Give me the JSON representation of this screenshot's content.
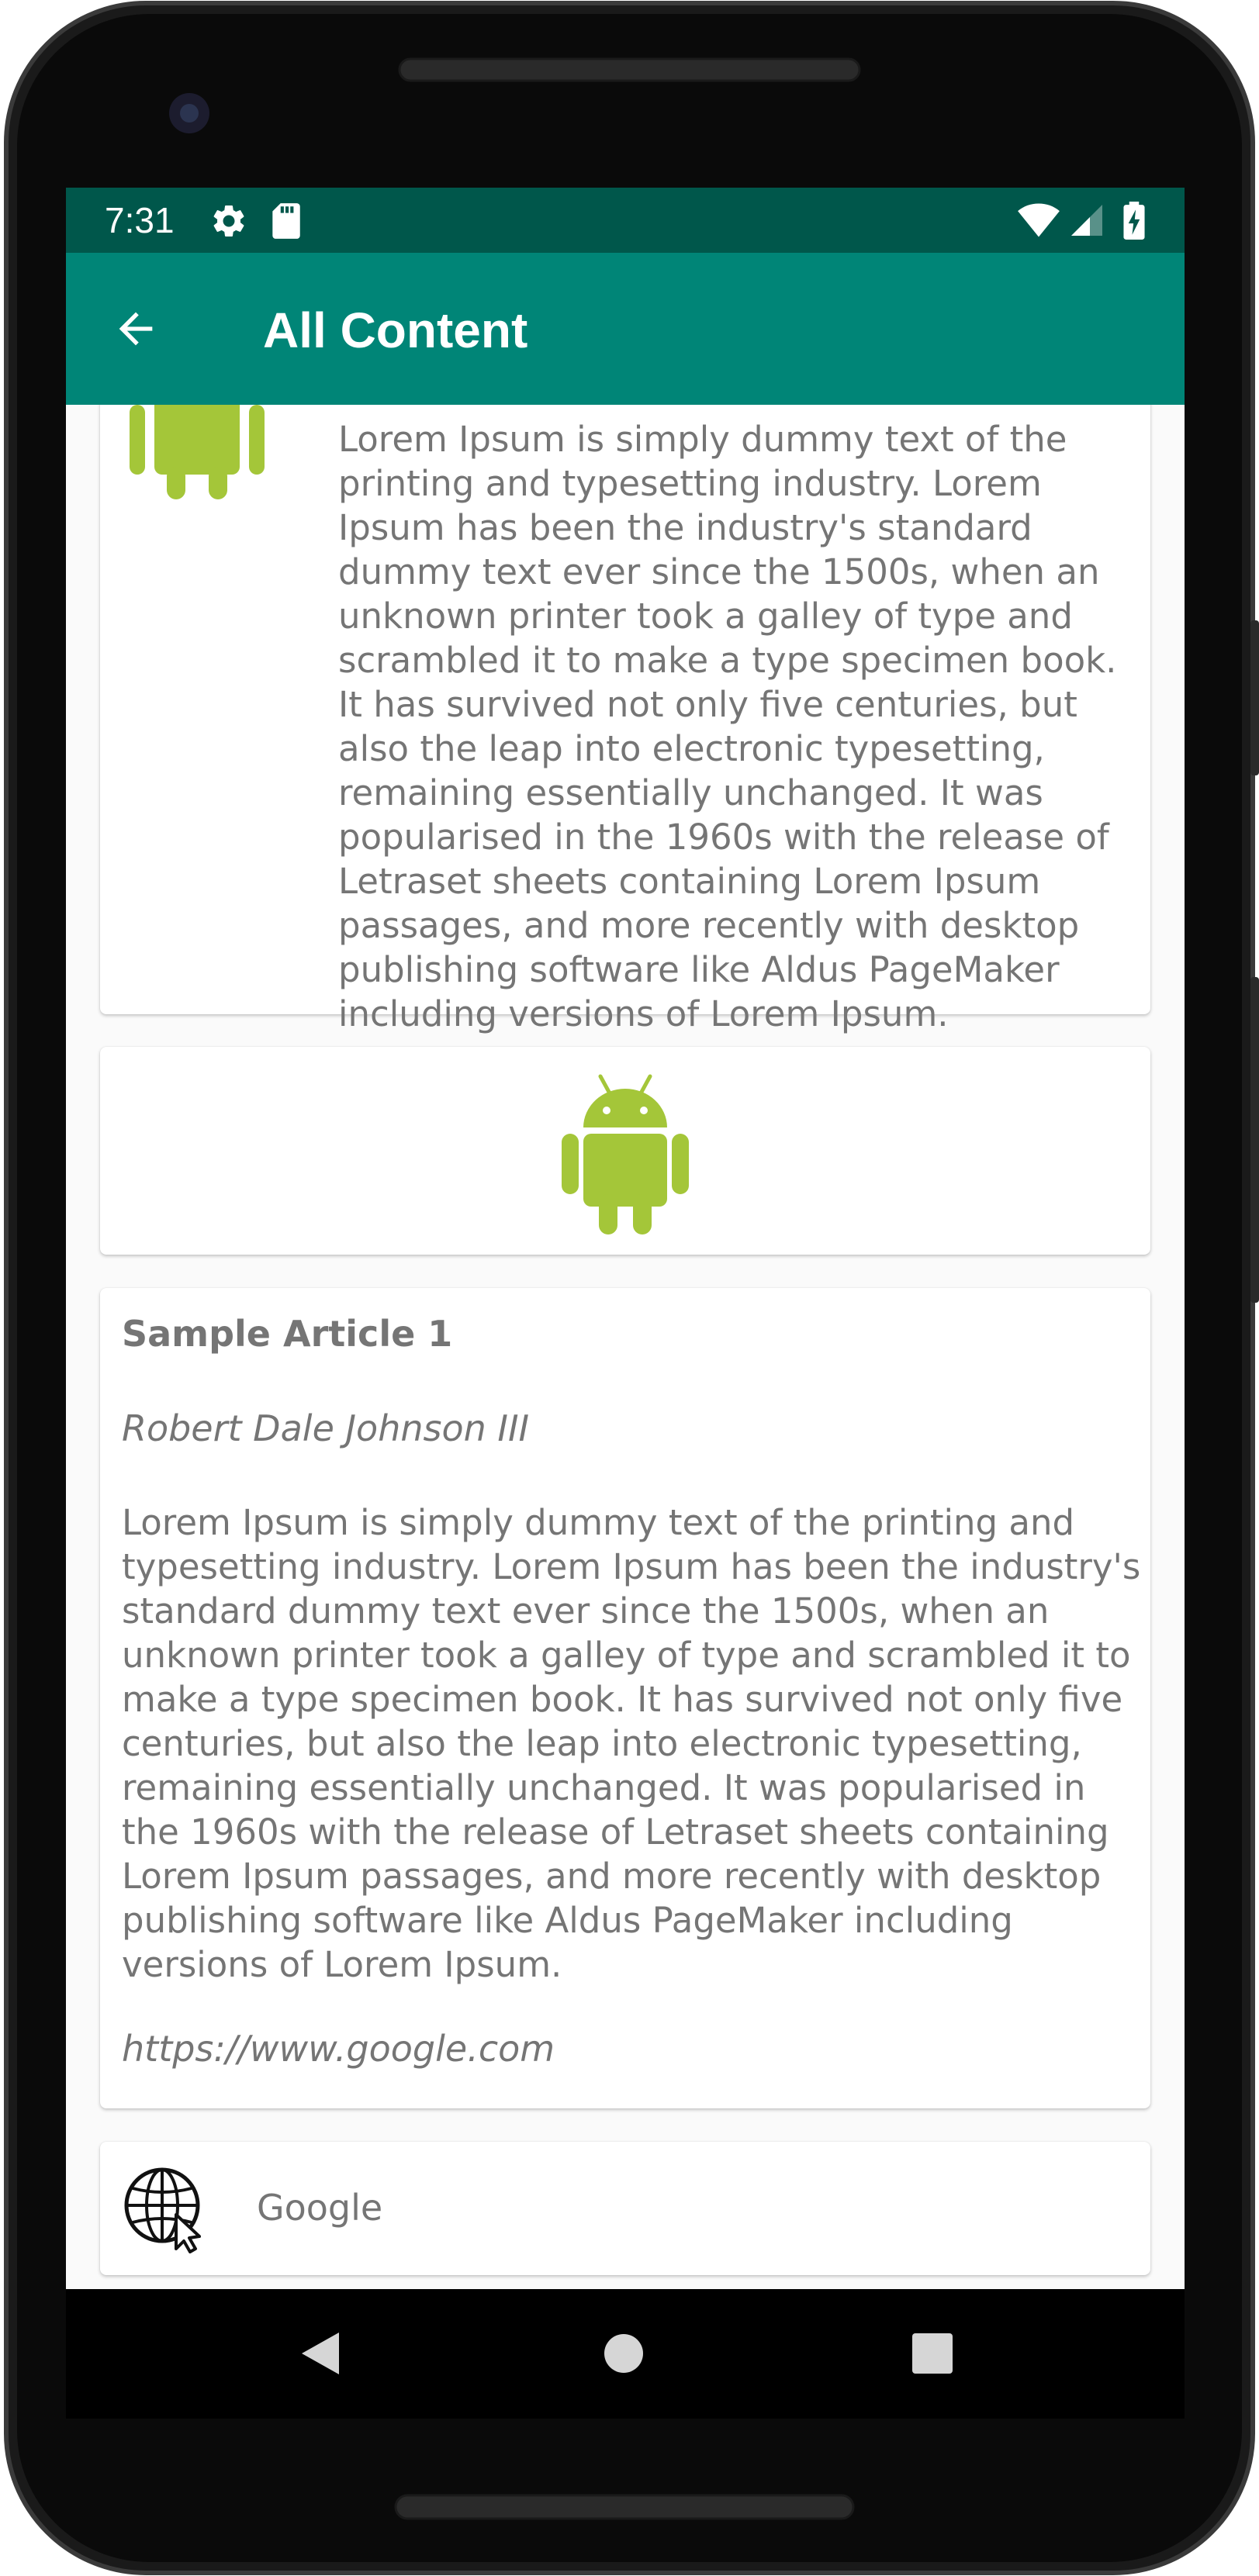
{
  "status_bar": {
    "time": "7:31",
    "icons": [
      "gear-icon",
      "sd-card-icon",
      "wifi-icon",
      "signal-icon",
      "battery-charging-icon"
    ]
  },
  "app_bar": {
    "title": "All Content",
    "back_icon": "arrow-back-icon"
  },
  "cards": {
    "image_text": {
      "image": "android-robot-icon",
      "text": "Lorem Ipsum is simply dummy text of the printing and typesetting industry. Lorem Ipsum has been the industry's standard dummy text ever since the 1500s, when an unknown printer took a galley of type and scrambled it to make a type specimen book. It has survived not only five centuries, but also the leap into electronic typesetting, remaining essentially unchanged. It was popularised in the 1960s with the release of Letraset sheets containing Lorem Ipsum passages, and more recently with desktop publishing software like Aldus PageMaker including versions of Lorem Ipsum."
    },
    "image": {
      "image": "android-robot-icon"
    },
    "article": {
      "title": "Sample Article 1",
      "author": "Robert Dale Johnson III",
      "body": "Lorem Ipsum is simply dummy text of the printing and typesetting industry. Lorem Ipsum has been the industry's standard dummy text ever since the 1500s, when an unknown printer took a galley of type and scrambled it to make a type specimen book. It has survived not only five centuries, but also the leap into electronic typesetting, remaining essentially unchanged. It was popularised in the 1960s with the release of Letraset sheets containing Lorem Ipsum passages, and more recently with desktop publishing software like Aldus PageMaker including versions of Lorem Ipsum.",
      "link": "https://www.google.com"
    },
    "link": {
      "icon": "globe-cursor-icon",
      "label": "Google"
    }
  },
  "nav_bar": {
    "buttons": [
      "back-triangle-icon",
      "home-circle-icon",
      "recents-square-icon"
    ]
  },
  "colors": {
    "status_bar": "#00574b",
    "app_bar": "#008577",
    "android_green": "#a4c639",
    "card_text": "#757575"
  }
}
